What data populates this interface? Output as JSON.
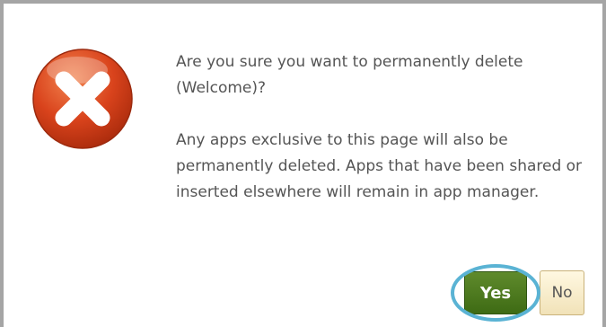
{
  "dialog": {
    "icon": "error-x-icon",
    "message": "Are you sure you want to permanently delete (Welcome)?",
    "detail": "Any apps exclusive to this page will also be permanently deleted. Apps that have been shared or inserted elsewhere will remain in app manager.",
    "yes_label": "Yes",
    "no_label": "No"
  },
  "colors": {
    "icon_red": "#d9431c",
    "yes_green": "#4a7a1e",
    "no_cream": "#f5e9c8",
    "highlight_blue": "#5ab3d4",
    "text_gray": "#555555",
    "border_gray": "#a5a5a5"
  }
}
